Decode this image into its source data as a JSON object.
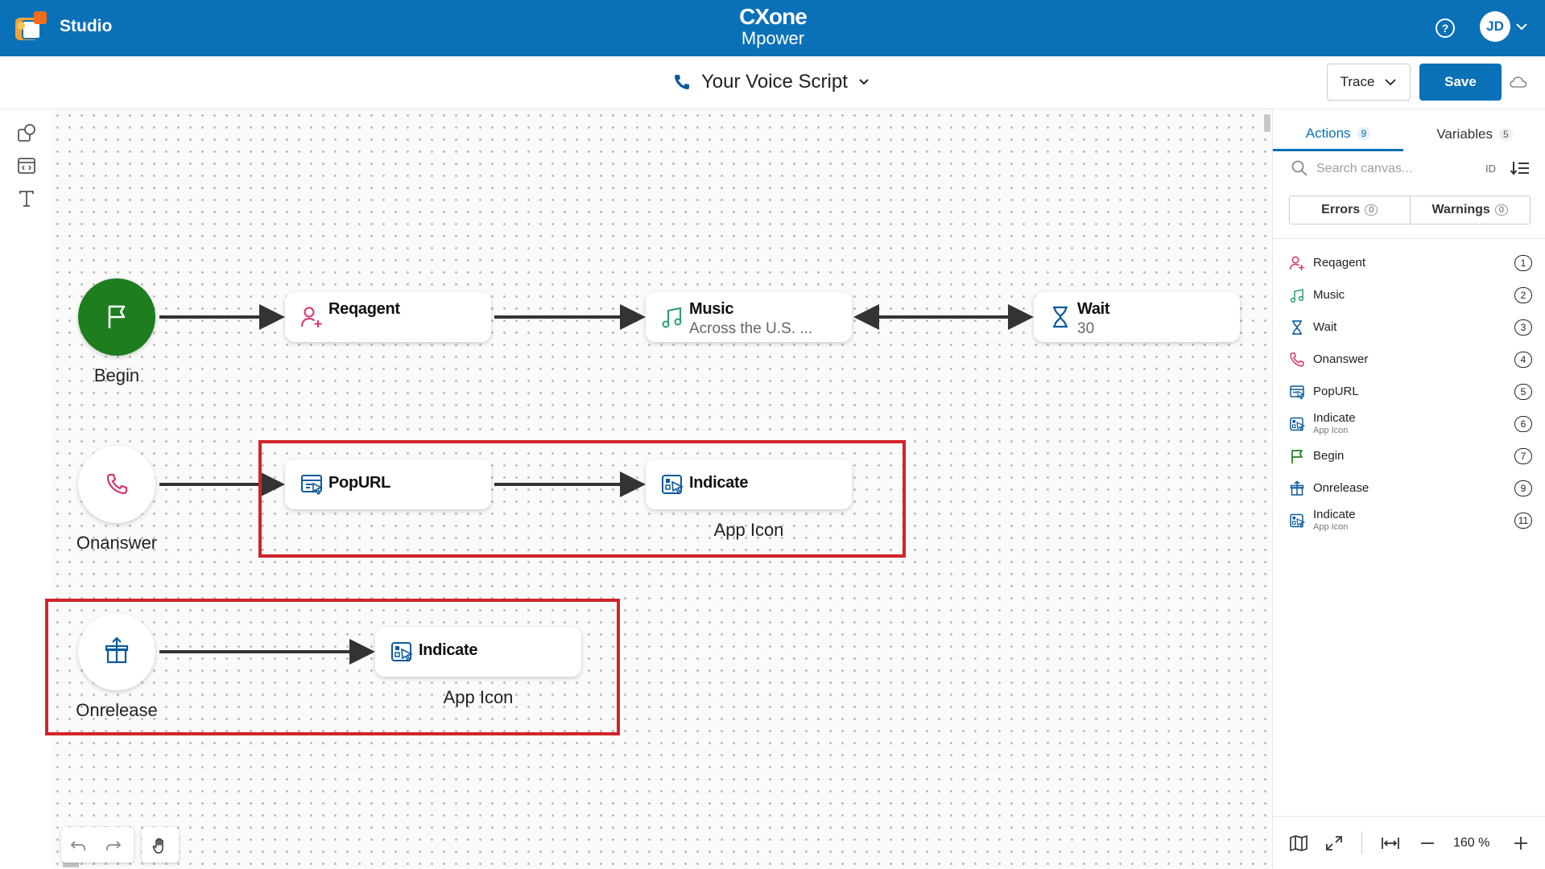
{
  "app": {
    "name": "Studio",
    "brand_line1": "CXone",
    "brand_line2": "Mpower",
    "user_initials": "JD"
  },
  "toolbar": {
    "script_name": "Your Voice Script",
    "trace_label": "Trace",
    "save_label": "Save"
  },
  "canvas": {
    "begin_label": "Begin",
    "onanswer_label": "Onanswer",
    "onrelease_label": "Onrelease",
    "reqagent_title": "Reqagent",
    "music_title": "Music",
    "music_sub": "Across the U.S. ...",
    "wait_title": "Wait",
    "wait_sub": "30",
    "popurl_title": "PopURL",
    "indicate1_title": "Indicate",
    "indicate1_caption": "App Icon",
    "indicate2_title": "Indicate",
    "indicate2_caption": "App Icon"
  },
  "panel": {
    "tabs": [
      {
        "label": "Actions",
        "count": "9"
      },
      {
        "label": "Variables",
        "count": "5"
      }
    ],
    "search_placeholder": "Search canvas...",
    "id_label": "ID",
    "errors": {
      "label": "Errors",
      "count": "0"
    },
    "warnings": {
      "label": "Warnings",
      "count": "0"
    },
    "items": [
      {
        "label": "Reqagent",
        "sub": "",
        "num": "1",
        "icon": "add-user-icon"
      },
      {
        "label": "Music",
        "sub": "",
        "num": "2",
        "icon": "music-icon"
      },
      {
        "label": "Wait",
        "sub": "",
        "num": "3",
        "icon": "hourglass-icon"
      },
      {
        "label": "Onanswer",
        "sub": "",
        "num": "4",
        "icon": "phone-icon"
      },
      {
        "label": "PopURL",
        "sub": "",
        "num": "5",
        "icon": "popurl-icon"
      },
      {
        "label": "Indicate",
        "sub": "App Icon",
        "num": "6",
        "icon": "indicate-icon"
      },
      {
        "label": "Begin",
        "sub": "",
        "num": "7",
        "icon": "flag-icon"
      },
      {
        "label": "Onrelease",
        "sub": "",
        "num": "9",
        "icon": "gift-icon"
      },
      {
        "label": "Indicate",
        "sub": "App Icon",
        "num": "11",
        "icon": "indicate-icon"
      }
    ],
    "zoom": "160 %"
  },
  "colors": {
    "header_blue": "#0a70b8",
    "begin_green": "#1e7d1e",
    "highlight_red": "#d2232a",
    "reqagent_pink": "#d6336c",
    "music_green": "#2e9e6a",
    "icon_blue": "#0a5a9c"
  }
}
